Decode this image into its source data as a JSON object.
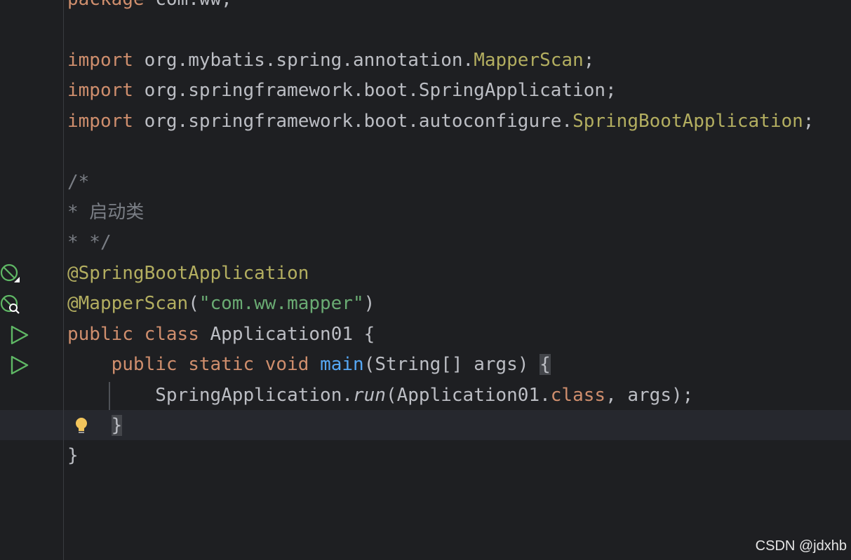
{
  "editor": {
    "lines": {
      "l1": {
        "kw": "package",
        "rest": " com.ww;"
      },
      "l2": {
        "kw": "import",
        "pkg": " org.mybatis.spring.annotation.",
        "cls": "MapperScan",
        "end": ";"
      },
      "l3": {
        "kw": "import",
        "pkg": " org.springframework.boot.SpringApplication;"
      },
      "l4": {
        "kw": "import",
        "pkg": " org.springframework.boot.autoconfigure.",
        "cls": "SpringBootApplication",
        "end": ";"
      },
      "l5": {
        "text": "/*"
      },
      "l6": {
        "text": "* 启动类"
      },
      "l7": {
        "text": "* */"
      },
      "l8": {
        "ann": "@SpringBootApplication"
      },
      "l9": {
        "ann": "@MapperScan",
        "open": "(",
        "str": "\"com.ww.mapper\"",
        "close": ")"
      },
      "l10": {
        "kw1": "public",
        "sp1": " ",
        "kw2": "class",
        "rest": " Application01 {"
      },
      "l11": {
        "indent": "    ",
        "kw1": "public",
        "sp1": " ",
        "kw2": "static",
        "sp2": " ",
        "kw3": "void",
        "sp3": " ",
        "fn": "main",
        "rest": "(String[] args) ",
        "brace": "{"
      },
      "l12": {
        "indent": "        ",
        "cls": "SpringApplication.",
        "method": "run",
        "mid": "(Application01.",
        "kw": "class",
        "end": ", args);"
      },
      "l13": {
        "indent": "    ",
        "brace": "}"
      },
      "l14": {
        "text": "}"
      }
    },
    "gutter": {
      "bean_icon": "spring-bean-icon",
      "mapper_icon": "spring-mapper-search-icon",
      "run_icon": "run-triangle-icon",
      "bulb_icon": "lightbulb-icon"
    }
  },
  "watermark": "CSDN @jdxhb",
  "colors": {
    "background": "#1e1f22",
    "keyword": "#cf8e6d",
    "annotation": "#b3ae60",
    "string": "#6aab73",
    "comment": "#7a7e85",
    "function": "#56a8f5",
    "text": "#bcbec4",
    "run_icon": "#5fb865",
    "bulb": "#f2c55c"
  }
}
